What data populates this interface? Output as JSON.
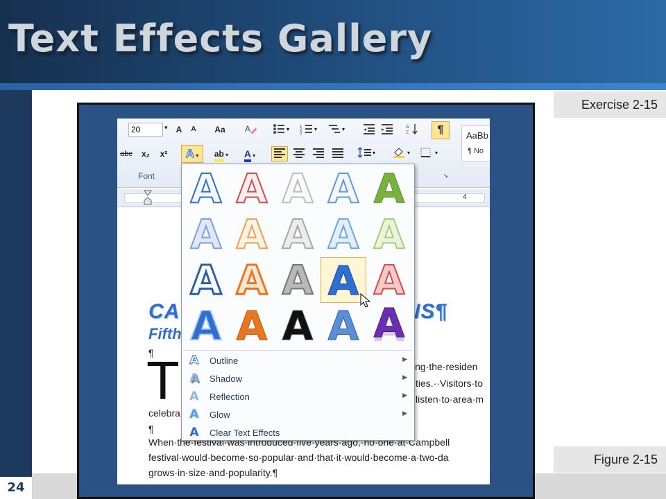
{
  "slide": {
    "title": "Text Effects Gallery",
    "page_number": "24",
    "exercise_label": "Exercise 2-15",
    "figure_label": "Figure 2-15"
  },
  "ribbon": {
    "font_size": "20",
    "grow_font": "A",
    "shrink_font": "A",
    "change_case": "Aa",
    "strikethrough": "abc",
    "subscript": "x₂",
    "superscript": "x²",
    "text_effects": "A",
    "highlight": "ab",
    "font_color": "A",
    "show_hide": "¶",
    "font_group_label": "Font",
    "style_sample": "AaBb",
    "style_name": "¶ No"
  },
  "ruler": {
    "mark": "4"
  },
  "document": {
    "heading1": "CA",
    "heading1_tail": "ONS¶",
    "heading2": "Fifth",
    "heading2_tail": "¶",
    "pilcrow1": "¶",
    "drop_cap": "T",
    "right_line1": "ing·the·residen",
    "right_line2": "ties.··Visitors·to",
    "right_line3": "listen·to·area·m",
    "line_celebra": "celebra",
    "pilcrow2": "¶",
    "line1": "When·the·festival·was·introduced·five·years·ago,·no·one·at·Campbell",
    "line2": "festival·would·become·so·popular·and·that·it·would·become·a·two-da",
    "line3": "grows·in·size·and·popularity.¶"
  },
  "gallery": {
    "tile_letter": "A",
    "menu": [
      {
        "label": "Outline",
        "icon": "outline-icon"
      },
      {
        "label": "Shadow",
        "icon": "shadow-icon"
      },
      {
        "label": "Reflection",
        "icon": "reflection-icon"
      },
      {
        "label": "Glow",
        "icon": "glow-icon"
      },
      {
        "label": "Clear Text Effects",
        "icon": "clear-effects-icon"
      }
    ],
    "colors": {
      "accent_blue": "#2e6fd0",
      "orange": "#e87722",
      "red": "#d54b4b",
      "green": "#78b43c",
      "purple": "#6a2fb0",
      "gray": "#9a9a9a"
    }
  }
}
